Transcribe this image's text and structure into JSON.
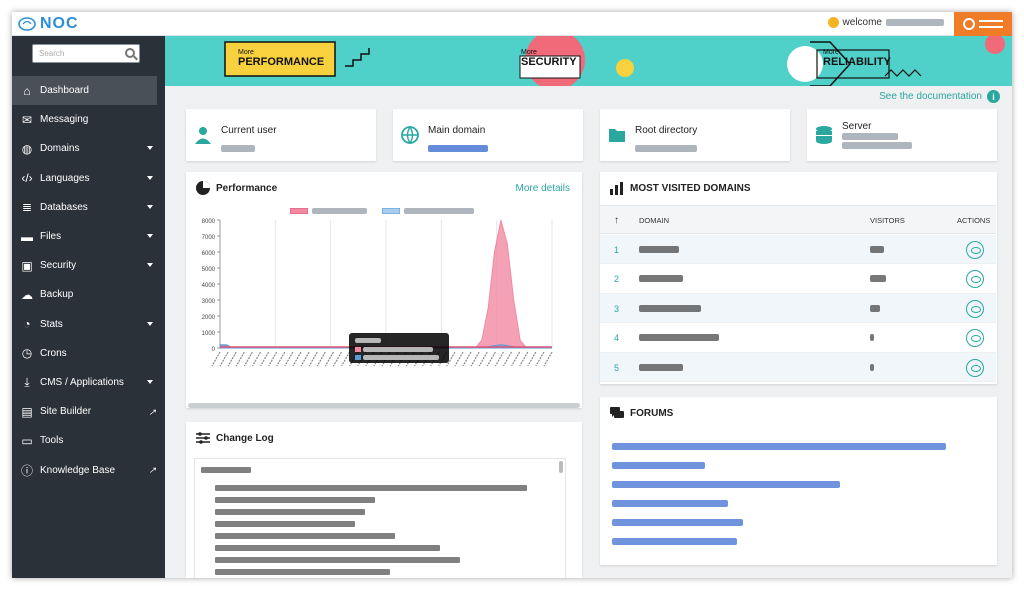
{
  "app": {
    "logo": "NOC",
    "welcome": "welcome"
  },
  "search": {
    "placeholder": "Search"
  },
  "sidebar": {
    "items": [
      {
        "label": "Dashboard",
        "icon": "home-icon",
        "glyph": "⌂",
        "active": true,
        "caret": false,
        "ext": false
      },
      {
        "label": "Messaging",
        "icon": "envelope-icon",
        "glyph": "✉",
        "active": false,
        "caret": false,
        "ext": false
      },
      {
        "label": "Domains",
        "icon": "globe-icon",
        "glyph": "◍",
        "active": false,
        "caret": true,
        "ext": false
      },
      {
        "label": "Languages",
        "icon": "code-icon",
        "glyph": "‹/›",
        "active": false,
        "caret": true,
        "ext": false
      },
      {
        "label": "Databases",
        "icon": "database-icon",
        "glyph": "≣",
        "active": false,
        "caret": true,
        "ext": false
      },
      {
        "label": "Files",
        "icon": "folder-icon",
        "glyph": "▬",
        "active": false,
        "caret": true,
        "ext": false
      },
      {
        "label": "Security",
        "icon": "lock-icon",
        "glyph": "▣",
        "active": false,
        "caret": true,
        "ext": false
      },
      {
        "label": "Backup",
        "icon": "cloud-upload-icon",
        "glyph": "☁",
        "active": false,
        "caret": false,
        "ext": false
      },
      {
        "label": "Stats",
        "icon": "pie-chart-icon",
        "glyph": "◔",
        "active": false,
        "caret": true,
        "ext": false
      },
      {
        "label": "Crons",
        "icon": "clock-icon",
        "glyph": "◷",
        "active": false,
        "caret": false,
        "ext": false
      },
      {
        "label": "CMS / Applications",
        "icon": "download-icon",
        "glyph": "⤓",
        "active": false,
        "caret": true,
        "ext": false
      },
      {
        "label": "Site Builder",
        "icon": "site-builder-icon",
        "glyph": "▤",
        "active": false,
        "caret": false,
        "ext": true
      },
      {
        "label": "Tools",
        "icon": "toolbox-icon",
        "glyph": "▭",
        "active": false,
        "caret": false,
        "ext": false
      },
      {
        "label": "Knowledge Base",
        "icon": "info-icon",
        "glyph": "ⓘ",
        "active": false,
        "caret": false,
        "ext": true
      }
    ]
  },
  "banner": {
    "performance": {
      "small": "More",
      "big": "PERFORMANCE"
    },
    "security": {
      "small": "More",
      "big": "SECURITY"
    },
    "reliability": {
      "small": "More",
      "big": "RELIABILITY"
    }
  },
  "doc_link": "See the documentation",
  "info_cards": {
    "current_user": "Current user",
    "main_domain": "Main domain",
    "root_directory": "Root directory",
    "server": "Server"
  },
  "performance": {
    "title": "Performance",
    "more": "More details"
  },
  "chart_data": {
    "type": "area",
    "y_ticks": [
      "8000",
      "7000",
      "6000",
      "5000",
      "4000",
      "3000",
      "2000",
      "1000",
      "0"
    ],
    "ylim": [
      0,
      8000
    ],
    "series": [
      {
        "color": "#f18aa2",
        "values": [
          150,
          150,
          0,
          0,
          0,
          0,
          0,
          0,
          0,
          0,
          0,
          0,
          0,
          0,
          0,
          0,
          0,
          0,
          0,
          0,
          0,
          0,
          0,
          0,
          0,
          0,
          0,
          0,
          0,
          0,
          0,
          0,
          0,
          0,
          0,
          0,
          0,
          0,
          0,
          0,
          0,
          500,
          2500,
          6000,
          8000,
          6500,
          3000,
          500,
          0,
          0,
          0,
          0,
          0
        ]
      },
      {
        "color": "#5b9bd5",
        "values": [
          200,
          200,
          0,
          0,
          0,
          0,
          0,
          0,
          0,
          0,
          0,
          0,
          0,
          0,
          0,
          0,
          0,
          0,
          0,
          0,
          0,
          0,
          0,
          0,
          0,
          0,
          0,
          0,
          0,
          0,
          0,
          0,
          0,
          0,
          0,
          0,
          0,
          0,
          0,
          0,
          0,
          0,
          80,
          150,
          200,
          150,
          80,
          0,
          0,
          0,
          0,
          0,
          0
        ]
      }
    ],
    "grid": true
  },
  "most_visited": {
    "title": "MOST VISITED DOMAINS",
    "col_domain": "DOMAIN",
    "col_visitors": "VISITORS",
    "col_actions": "ACTIONS",
    "rows": [
      {
        "rank": "1"
      },
      {
        "rank": "2"
      },
      {
        "rank": "3"
      },
      {
        "rank": "4"
      },
      {
        "rank": "5"
      }
    ]
  },
  "forums": {
    "title": "FORUMS"
  },
  "changelog": {
    "title": "Change Log"
  }
}
